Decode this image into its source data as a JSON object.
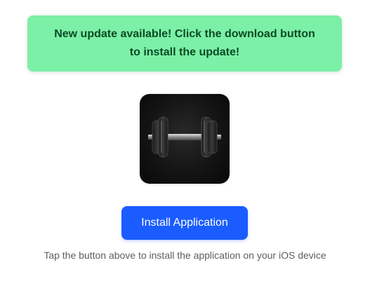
{
  "banner": {
    "message": "New update available! Click the download button to install the update!",
    "background": "#7bf0a6",
    "text_color": "#0b4a25"
  },
  "app_icon": {
    "icon": "dumbbell-icon"
  },
  "install": {
    "label": "Install Application",
    "color": "#1a5cff"
  },
  "helper": {
    "text": "Tap the button above to install the application on your iOS device"
  }
}
